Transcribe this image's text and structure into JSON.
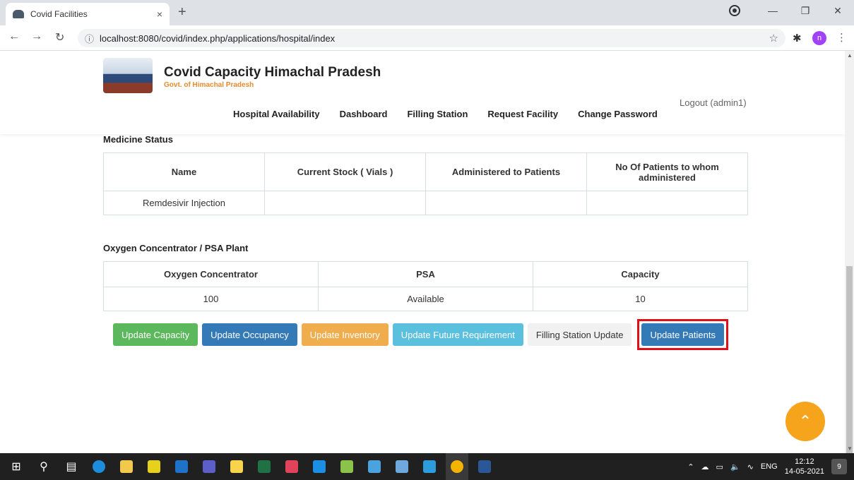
{
  "browser": {
    "tab_title": "Covid Facilities",
    "tab_close": "×",
    "new_tab": "+",
    "url": "localhost:8080/covid/index.php/applications/hospital/index",
    "profile_initial": "n"
  },
  "site": {
    "title": "Covid Capacity Himachal Pradesh",
    "subtitle": "Govt. of Himachal Pradesh",
    "logout": "Logout (admin1)",
    "nav": [
      "Hospital Availability",
      "Dashboard",
      "Filling Station",
      "Request Facility",
      "Change Password"
    ]
  },
  "medicine": {
    "title": "Medicine Status",
    "headers": [
      "Name",
      "Current Stock ( Vials )",
      "Administered to Patients",
      "No Of Patients to whom administered"
    ],
    "rows": [
      [
        "Remdesivir Injection",
        "",
        "",
        ""
      ]
    ]
  },
  "oxygen": {
    "title": "Oxygen Concentrator / PSA Plant",
    "headers": [
      "Oxygen Concentrator",
      "PSA",
      "Capacity"
    ],
    "rows": [
      [
        "100",
        "Available",
        "10"
      ]
    ]
  },
  "actions": {
    "update_capacity": "Update Capacity",
    "update_occupancy": "Update Occupancy",
    "update_inventory": "Update Inventory",
    "update_future": "Update Future Requirement",
    "filling_station_update": "Filling Station Update",
    "update_patients": "Update Patients"
  },
  "taskbar": {
    "language": "ENG",
    "time": "12:12",
    "date": "14-05-2021",
    "notifications": "9"
  },
  "colors": {
    "green": "#5cb85c",
    "blue": "#337ab7",
    "orange": "#f0ad4e",
    "cyan": "#5bc0de",
    "highlight": "#e0101a",
    "fab": "#f7a41d"
  }
}
